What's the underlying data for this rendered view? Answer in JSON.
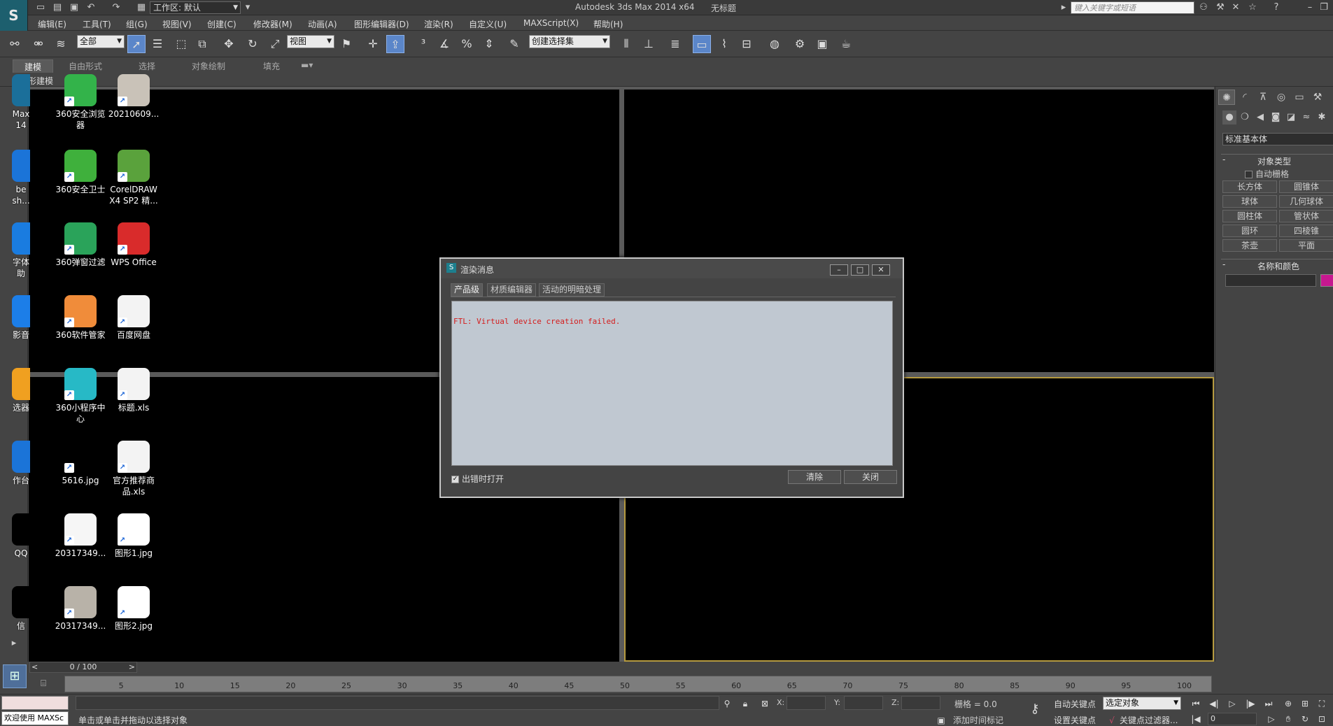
{
  "titlebar": {
    "app_title": "Autodesk 3ds Max  2014 x64",
    "doc_title": "无标题",
    "workspace": "工作区: 默认",
    "search_placeholder": "键入关键字或短语"
  },
  "menu": [
    "编辑(E)",
    "工具(T)",
    "组(G)",
    "视图(V)",
    "创建(C)",
    "修改器(M)",
    "动画(A)",
    "图形编辑器(D)",
    "渲染(R)",
    "自定义(U)",
    "MAXScript(X)",
    "帮助(H)"
  ],
  "toolbar": {
    "selection_filter": "全部",
    "ref_coord": "视图",
    "named_selection": "创建选择集"
  },
  "ribbon": {
    "tabs": [
      "建模",
      "自由形式",
      "选择",
      "对象绘制",
      "填充"
    ],
    "sub_label": "多边形建模"
  },
  "desktop_icons": [
    {
      "label": "Max\n14",
      "icon": "max-shortcut-icon",
      "color": "#1b6f9a",
      "cut": true
    },
    {
      "label": "360安全浏览\n器",
      "icon": "browser-icon",
      "color": "#33b34a"
    },
    {
      "label": "20210609...",
      "icon": "image-thumbnail-icon",
      "color": "#c9c2b8"
    },
    {
      "label": "be\nsh...",
      "icon": "photoshop-icon",
      "color": "#1b74d8",
      "cut": true
    },
    {
      "label": "360安全卫士",
      "icon": "shield-icon",
      "color": "#3fb03c"
    },
    {
      "label": "CorelDRAW\nX4 SP2 精...",
      "icon": "coreldraw-icon",
      "color": "#5aa23c"
    },
    {
      "label": "字体助",
      "icon": "font-assistant-icon",
      "color": "#1a7ce0",
      "cut": true
    },
    {
      "label": "360弹窗过滤",
      "icon": "popup-filter-icon",
      "color": "#2aa35a"
    },
    {
      "label": "WPS Office",
      "icon": "wps-icon",
      "color": "#d92b2b"
    },
    {
      "label": "影音",
      "icon": "media-player-icon",
      "color": "#1c7ee8",
      "cut": true
    },
    {
      "label": "360软件管家",
      "icon": "software-manager-icon",
      "color": "#f08c3a"
    },
    {
      "label": "百度网盘",
      "icon": "cloud-disk-icon",
      "color": "#f3f3f3"
    },
    {
      "label": "选器",
      "icon": "selector-icon",
      "color": "#f0a020",
      "cut": true
    },
    {
      "label": "360小程序中\n心",
      "icon": "miniprogram-icon",
      "color": "#27b9c6"
    },
    {
      "label": "标题.xls",
      "icon": "spreadsheet-icon",
      "color": "#f3f3f3"
    },
    {
      "label": "作台",
      "icon": "workbench-icon",
      "color": "#1b74d8",
      "cut": true
    },
    {
      "label": "5616.jpg",
      "icon": "jpg-file-icon",
      "color": "#000000"
    },
    {
      "label": "官方推荐商\n品.xls",
      "icon": "spreadsheet-icon",
      "color": "#f3f3f3"
    },
    {
      "label": "QQ",
      "icon": "qq-icon",
      "color": "#000000",
      "cut": true
    },
    {
      "label": "20317349...",
      "icon": "certificate-thumbnail-icon",
      "color": "#f6f6f6"
    },
    {
      "label": "图形1.jpg",
      "icon": "jpg-file-icon",
      "color": "#ffffff"
    },
    {
      "label": "信",
      "icon": "wechat-icon",
      "color": "#000000",
      "cut": true
    },
    {
      "label": "20317349...",
      "icon": "certificate-thumbnail-icon",
      "color": "#b8b2a8"
    },
    {
      "label": "图形2.jpg",
      "icon": "jpg-file-icon",
      "color": "#ffffff"
    }
  ],
  "command_panel": {
    "category": "标准基本体",
    "rollout_object_type": "对象类型",
    "autogrid": "自动栅格",
    "buttons": [
      "长方体",
      "圆锥体",
      "球体",
      "几何球体",
      "圆柱体",
      "管状体",
      "圆环",
      "四棱锥",
      "茶壶",
      "平面"
    ],
    "rollout_name_color": "名称和颜色",
    "swatch_color": "#c6188f"
  },
  "timeline": {
    "slider": "0 / 100",
    "ticks": [
      "5",
      "10",
      "15",
      "20",
      "25",
      "30",
      "35",
      "40",
      "45",
      "50",
      "55",
      "60",
      "65",
      "70",
      "75",
      "80",
      "85",
      "90",
      "95",
      "100"
    ]
  },
  "status": {
    "welcome": "欢迎使用 MAXSc",
    "prompt": "单击或单击并拖动以选择对象",
    "x_label": "X:",
    "y_label": "Y:",
    "z_label": "Z:",
    "grid": "栅格 = 0.0",
    "add_time_tag": "添加时间标记",
    "auto_key": "自动关键点",
    "set_key": "设置关键点",
    "selected_object": "选定对象",
    "key_filters": "关键点过滤器...",
    "frame": "0"
  },
  "dialog": {
    "title": "渲染消息",
    "tabs": [
      "产品级",
      "材质编辑器",
      "活动的明暗处理"
    ],
    "message": "FTL: Virtual device creation failed.",
    "open_on_error": "出错时打开",
    "clear": "清除",
    "close": "关闭"
  }
}
